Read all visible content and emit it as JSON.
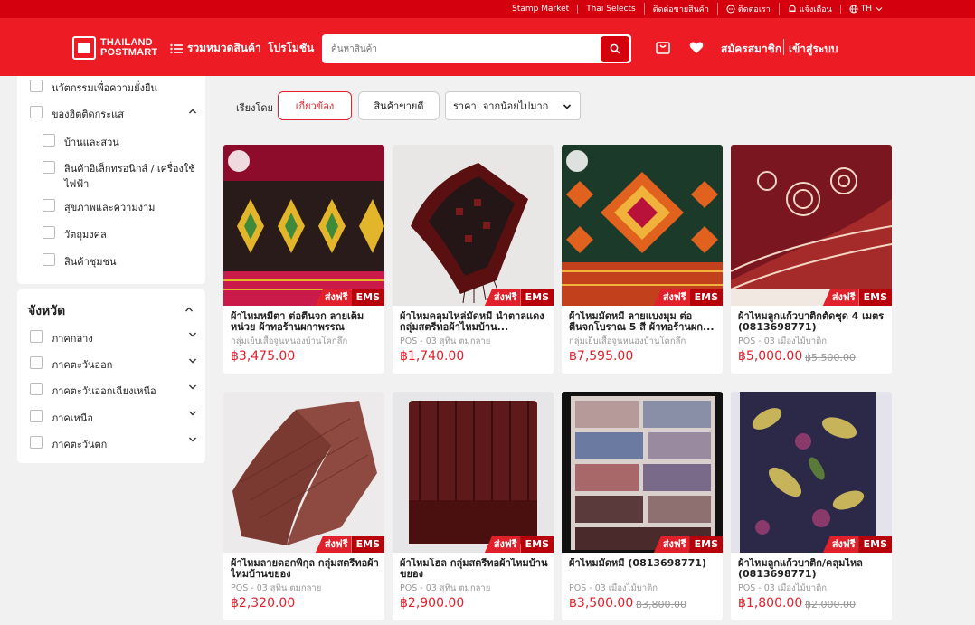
{
  "topbar": {
    "links": [
      "Stamp Market",
      "Thai Selects",
      "ติดต่อขายสินค้า",
      "ติดต่อเรา",
      "แจ้งเตือน",
      "TH"
    ]
  },
  "header": {
    "logo_line1": "THAILAND",
    "logo_line2": "POSTMART",
    "categories_label": "รวมหมวดสินค้า",
    "promo_label": "โปรโมชัน",
    "search_placeholder": "ค้นหาสินค้า",
    "register_label": "สมัครสมาชิก",
    "login_label": "เข้าสู่ระบบ"
  },
  "sidebar": {
    "top_items": [
      "นวัตกรรมเพื่อความยั่งยืน",
      "ของฮิตติดกระแส"
    ],
    "sub_items": [
      "บ้านและสวน",
      "สินค้าอิเล็กทรอนิกส์ / เครื่องใช้ไฟฟ้า",
      "สุขภาพและความงาม",
      "วัตถุมงคล",
      "สินค้าชุมชน"
    ],
    "province_title": "จังหวัด",
    "regions": [
      "ภาคกลาง",
      "ภาคตะวันออก",
      "ภาคตะวันออกเฉียงเหนือ",
      "ภาคเหนือ",
      "ภาคตะวันตก"
    ]
  },
  "sort": {
    "label": "เรียงโดย",
    "relevant": "เกี่ยวข้อง",
    "bestseller": "สินค้าขายดี",
    "price_select": "ราคา: จากน้อยไปมาก"
  },
  "badge": {
    "free": "ส่งฟรี",
    "ems": "EMS"
  },
  "products": [
    {
      "name": "ผ้าไหมหมี่ตา ต่อตีนจก ลายเต็มหน่วย ผ้าทอร้านผกาพรรณ",
      "shop": "กลุ่มเย็บเสื้อจูนหนองบ้านโคกลึก",
      "price": "฿3,475.00",
      "old_price": ""
    },
    {
      "name": "ผ้าไหมคลุมไหล่มัดหมี่ น้ำตาลแดง กลุ่มสตรีทอผ้าไหมบ้าน...",
      "shop": "POS - 03 สุทิน ตมกลาย",
      "price": "฿1,740.00",
      "old_price": ""
    },
    {
      "name": "ผ้าไหมมัดหมี่ ลายแบงมุม ต่อตีนจกโบราณ 5 สี ผ้าทอร้านผก...",
      "shop": "กลุ่มเย็บเสื้อจูนหนองบ้านโคกลึก",
      "price": "฿7,595.00",
      "old_price": ""
    },
    {
      "name": "ผ้าไหมลูกแก้วบาติกตัดชุด 4 เมตร (0813698771)",
      "shop": "POS - 03 เมืองไม้บาติก",
      "price": "฿5,000.00",
      "old_price": "฿5,500.00"
    },
    {
      "name": "ผ้าไหมลายดอกพิกุล กลุ่มสตรีทอผ้าไหมบ้านขยอง",
      "shop": "POS - 03 สุทิน ตมกลาย",
      "price": "฿2,320.00",
      "old_price": ""
    },
    {
      "name": "ผ้าไหมโฮล กลุ่มสตรีทอผ้าไหมบ้านขยอง",
      "shop": "POS - 03 สุทิน ตมกลาย",
      "price": "฿2,900.00",
      "old_price": ""
    },
    {
      "name": "ผ้าไหมมัดหมี่ (0813698771)",
      "shop": "POS - 03 เมืองไม้บาติก",
      "price": "฿3,500.00",
      "old_price": "฿3,800.00"
    },
    {
      "name": "ผ้าไหมลูกแก้วบาติก/คลุมไหล (0813698771)",
      "shop": "POS - 03 เมืองไม้บาติก",
      "price": "฿1,800.00",
      "old_price": "฿2,000.00"
    }
  ]
}
